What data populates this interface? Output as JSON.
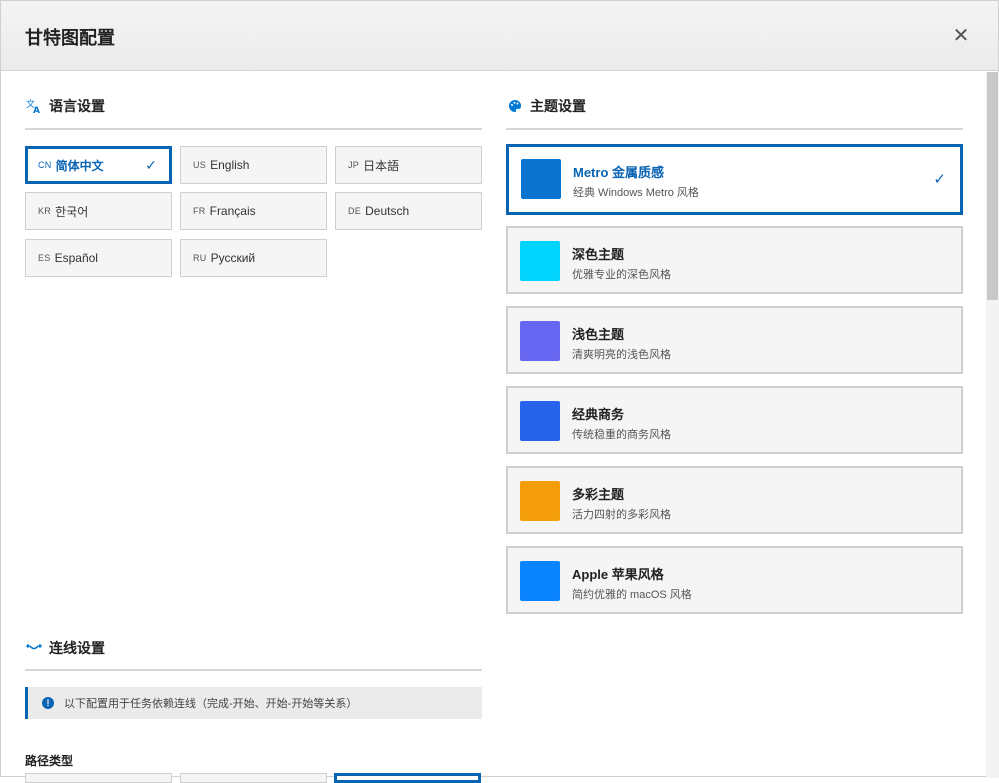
{
  "dialog": {
    "title": "甘特图配置",
    "close_icon": "close-icon",
    "close_glyph": "✕"
  },
  "language": {
    "heading": "语言设置",
    "icon": "translate-icon",
    "options": [
      {
        "code": "CN",
        "label": "简体中文",
        "selected": true
      },
      {
        "code": "US",
        "label": "English",
        "selected": false
      },
      {
        "code": "JP",
        "label": "日本語",
        "selected": false
      },
      {
        "code": "KR",
        "label": "한국어",
        "selected": false
      },
      {
        "code": "FR",
        "label": "Français",
        "selected": false
      },
      {
        "code": "DE",
        "label": "Deutsch",
        "selected": false
      },
      {
        "code": "ES",
        "label": "Español",
        "selected": false
      },
      {
        "code": "RU",
        "label": "Русский",
        "selected": false
      }
    ],
    "check_glyph": "✓"
  },
  "theme": {
    "heading": "主题设置",
    "icon": "palette-icon",
    "options": [
      {
        "name": "Metro 金属质感",
        "desc": "经典 Windows Metro 风格",
        "color": "#0a74d0",
        "selected": true
      },
      {
        "name": "深色主题",
        "desc": "优雅专业的深色风格",
        "color": "#00d4ff",
        "selected": false
      },
      {
        "name": "浅色主题",
        "desc": "清爽明亮的浅色风格",
        "color": "#6666f0",
        "selected": false
      },
      {
        "name": "经典商务",
        "desc": "传统稳重的商务风格",
        "color": "#2563eb",
        "selected": false
      },
      {
        "name": "多彩主题",
        "desc": "活力四射的多彩风格",
        "color": "#f59e0b",
        "selected": false
      },
      {
        "name": "Apple 苹果风格",
        "desc": "简约优雅的 macOS 风格",
        "color": "#0a84ff",
        "selected": false
      }
    ],
    "check_glyph": "✓"
  },
  "connector": {
    "heading": "连线设置",
    "icon": "connector-icon",
    "info_text": "以下配置用于任务依赖连线（完成-开始、开始-开始等关系）",
    "info_icon": "info-icon",
    "route_label": "路径类型"
  },
  "colors": {
    "accent": "#0a64b4"
  }
}
